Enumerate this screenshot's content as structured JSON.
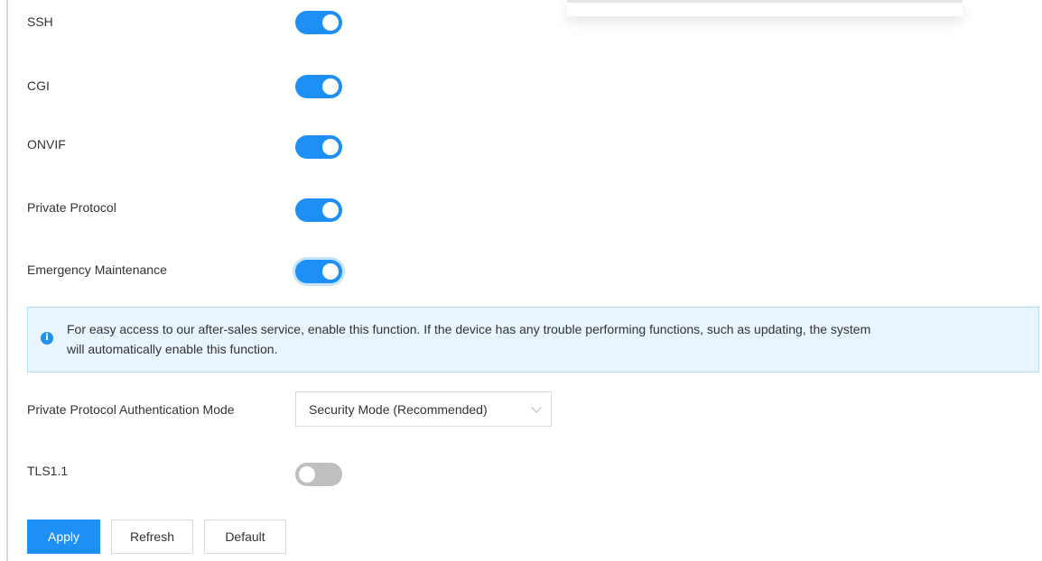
{
  "settings": {
    "ssh_label": "SSH",
    "ssh_enabled": true,
    "cgi_label": "CGI",
    "cgi_enabled": true,
    "onvif_label": "ONVIF",
    "onvif_enabled": true,
    "private_protocol_label": "Private Protocol",
    "private_protocol_enabled": true,
    "emergency_label": "Emergency Maintenance",
    "emergency_enabled": true,
    "tls_label": "TLS1.1",
    "tls_enabled": false
  },
  "info": {
    "line1": "For easy access to our after-sales service, enable this function. If the device has any trouble performing functions, such as updating, the system",
    "line2": "will automatically enable this function."
  },
  "auth_mode": {
    "label": "Private Protocol Authentication Mode",
    "value": "Security Mode (Recommended)"
  },
  "buttons": {
    "apply": "Apply",
    "refresh": "Refresh",
    "default": "Default"
  },
  "colors": {
    "accent": "#1e8ff5",
    "switch_off": "#bfbfbf",
    "info_bg": "#e8f5fe"
  }
}
